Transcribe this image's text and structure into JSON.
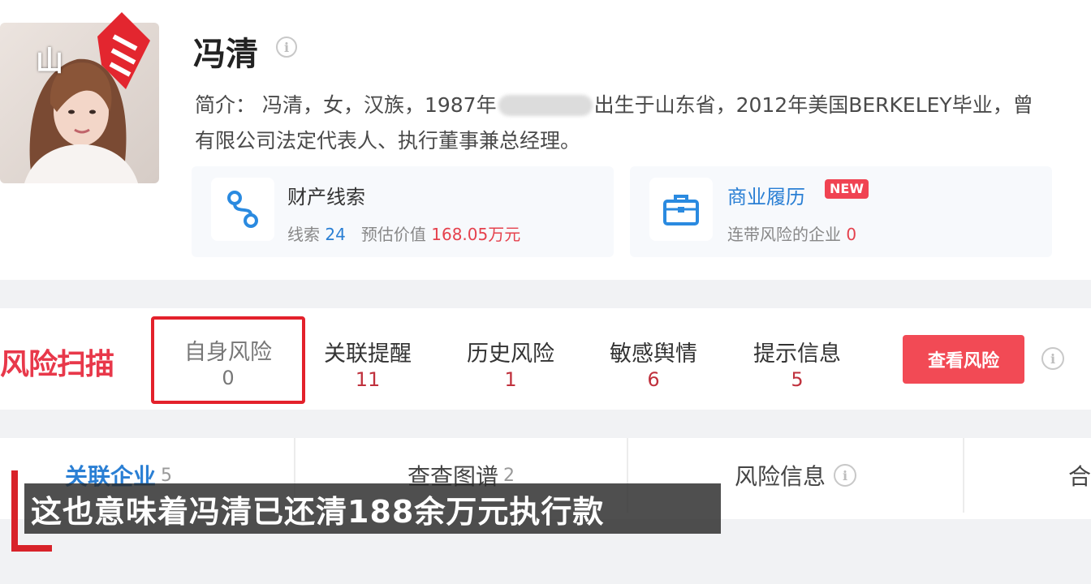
{
  "overlay": {
    "station_logo_text": "山",
    "subtitle": "这也意味着冯清已还清188余万元执行款"
  },
  "profile": {
    "name": "冯清",
    "intro_line1_part1": "简介： 冯清，女，汉族，1987年",
    "intro_line1_part2": "出生于山东省，2012年美国BERKELEY毕业，曾",
    "intro_line2": "有限公司法定代表人、执行董事兼总经理。",
    "info_icon_glyph": "i"
  },
  "property_clues": {
    "title": "财产线索",
    "clues_label": "线索",
    "clues_count": "24",
    "value_label": "预估价值",
    "value": "168.05万元"
  },
  "business_history": {
    "title": "商业履历",
    "badge": "NEW",
    "related_label": "连带风险的企业",
    "related_count": "0"
  },
  "risk_scan": {
    "title": "风险扫描",
    "items": [
      {
        "label": "自身风险",
        "count": "0"
      },
      {
        "label": "关联提醒",
        "count": "11"
      },
      {
        "label": "历史风险",
        "count": "1"
      },
      {
        "label": "敏感舆情",
        "count": "6"
      },
      {
        "label": "提示信息",
        "count": "5"
      }
    ],
    "view_button": "查看风险"
  },
  "tabs": [
    {
      "label": "关联企业",
      "count": "5"
    },
    {
      "label": "查查图谱",
      "count": "2"
    },
    {
      "label": "风险信息",
      "count": ""
    },
    {
      "label": "合",
      "count": ""
    }
  ],
  "colors": {
    "accent_blue": "#2a7fd4",
    "risk_red": "#e8384a",
    "button_red": "#f24a55",
    "selected_border": "#e3212b"
  }
}
